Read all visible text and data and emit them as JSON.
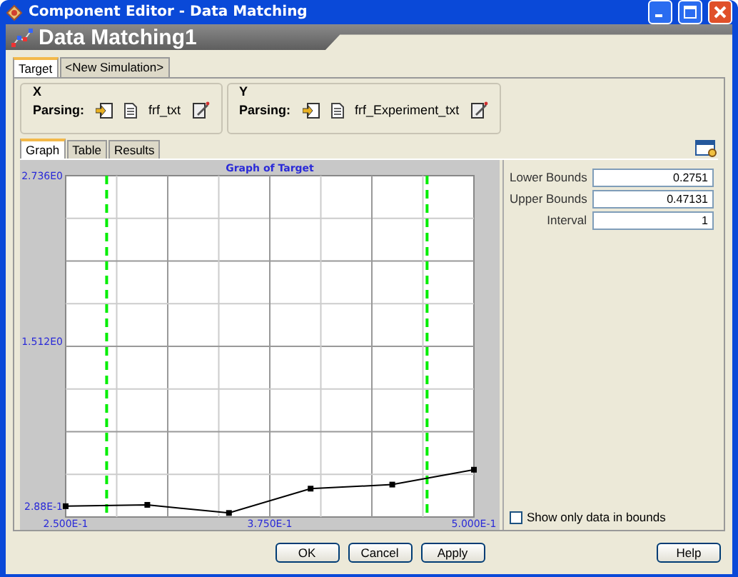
{
  "window": {
    "title": "Component Editor - Data Matching"
  },
  "header": {
    "title": "Data Matching1"
  },
  "tabs": [
    {
      "label": "Target",
      "selected": true
    },
    {
      "label": "<New Simulation>",
      "selected": false
    }
  ],
  "axes": [
    {
      "label": "X",
      "parsing_label": "Parsing:",
      "file": "frf_txt"
    },
    {
      "label": "Y",
      "parsing_label": "Parsing:",
      "file": "frf_Experiment_txt"
    }
  ],
  "view_tabs": [
    {
      "label": "Graph",
      "selected": true
    },
    {
      "label": "Table",
      "selected": false
    },
    {
      "label": "Results",
      "selected": false
    }
  ],
  "chart": {
    "chart_data": {
      "type": "line",
      "title": "Graph of Target",
      "x": [
        0.25,
        0.3,
        0.35,
        0.4,
        0.45,
        0.5
      ],
      "series": [
        {
          "color": "#000000",
          "marker": "square",
          "values": [
            0.29,
            0.3,
            0.24,
            0.42,
            0.45,
            0.56
          ]
        }
      ],
      "xlim": [
        0.25,
        0.5
      ],
      "ylim": [
        0.21,
        2.736
      ],
      "xticks": [
        {
          "value": 0.25,
          "label": "2.500E-1"
        },
        {
          "value": 0.375,
          "label": "3.750E-1"
        },
        {
          "value": 0.5,
          "label": "5.000E-1"
        }
      ],
      "yticks": [
        {
          "value": 0.288,
          "label": "2.88E-1"
        },
        {
          "value": 1.512,
          "label": "1.512E0"
        },
        {
          "value": 2.736,
          "label": "2.736E0"
        }
      ],
      "ref_lines": [
        {
          "axis": "x",
          "value": 0.2751
        },
        {
          "axis": "x",
          "value": 0.47131
        }
      ]
    }
  },
  "bounds": [
    {
      "label": "Lower Bounds",
      "value": "0.2751"
    },
    {
      "label": "Upper Bounds",
      "value": "0.47131"
    },
    {
      "label": "Interval",
      "value": "1"
    }
  ],
  "show_only_in_bounds": {
    "label": "Show only data in bounds",
    "checked": false
  },
  "buttons": [
    {
      "label": "OK"
    },
    {
      "label": "Cancel"
    },
    {
      "label": "Apply"
    }
  ],
  "help_button": {
    "label": "Help"
  }
}
